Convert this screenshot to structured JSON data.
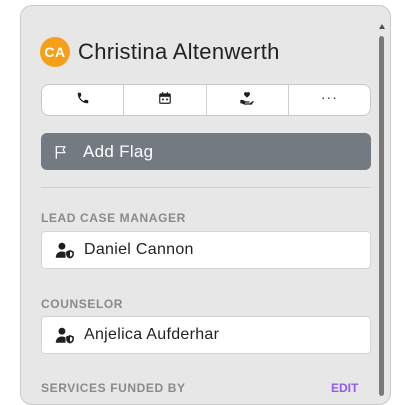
{
  "client": {
    "initials": "CA",
    "name": "Christina Altenwerth",
    "avatar_color": "#f6a01a"
  },
  "actions": [
    {
      "icon": "phone-icon"
    },
    {
      "icon": "calendar-icon"
    },
    {
      "icon": "hand-heart-icon"
    },
    {
      "icon": "more-icon",
      "label": "···"
    }
  ],
  "flag_button": {
    "label": "Add Flag",
    "icon": "flag-icon",
    "color": "#737a82"
  },
  "lead_case_manager": {
    "label": "LEAD CASE MANAGER",
    "name": "Daniel Cannon",
    "icon": "user-shield-icon"
  },
  "counselor": {
    "label": "COUNSELOR",
    "name": "Anjelica Aufderhar",
    "icon": "user-shield-icon"
  },
  "services_section": {
    "label": "SERVICES FUNDED BY",
    "edit_label": "EDIT",
    "edit_color": "#8b5cf6"
  }
}
